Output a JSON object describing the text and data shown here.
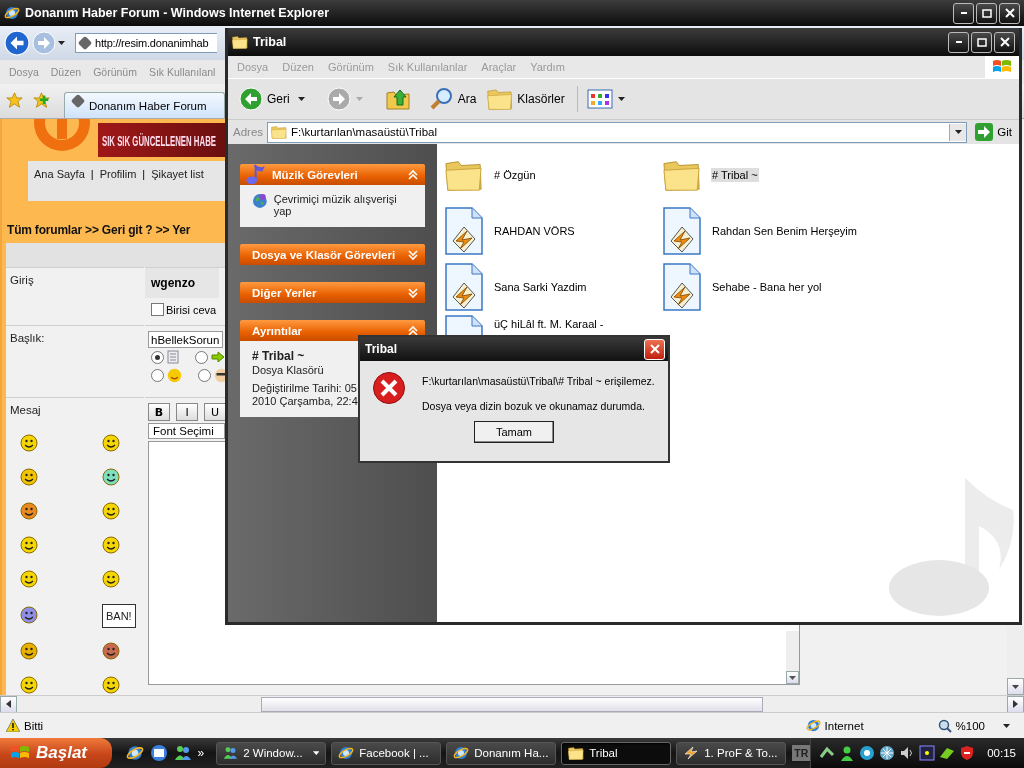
{
  "ie_window": {
    "title": "Donanım Haber Forum - Windows Internet Explorer",
    "address": "http://resim.donanimhab",
    "menu": [
      "Dosya",
      "Düzen",
      "Görünüm",
      "Sık Kullanılanl"
    ],
    "tabs": [
      {
        "label": "Donanım Haber Forum",
        "selected": true
      }
    ],
    "page": {
      "banner_text": "SIK SIK GÜNCELLENEN HABE",
      "nav": [
        {
          "kind": "link",
          "label": "Ana Sayfa"
        },
        {
          "kind": "separator",
          "label": "|"
        },
        {
          "kind": "link",
          "label": "Profilim"
        },
        {
          "kind": "separator",
          "label": "|"
        },
        {
          "kind": "link",
          "label": "Şikayet list"
        }
      ],
      "breadcrumb": "Tüm forumlar >> Geri git ? >> Yer",
      "labels": [
        "Giriş",
        "Başlık:",
        "Mesaj"
      ],
      "username": "wgenzo",
      "notify": {
        "label": "Birisi ceva",
        "checked": false
      },
      "title_value": "hBellekSorun",
      "icon_radios": [
        {
          "selected": true
        },
        {
          "selected": false
        },
        {
          "selected": false
        },
        {
          "selected": false
        }
      ],
      "format_buttons": [
        "B",
        "I",
        "U"
      ],
      "font_select": "Font Seçimi",
      "ban_sign": "BAN!"
    },
    "status": {
      "text": "Bitti",
      "zone": "Internet",
      "zoom": "%100"
    }
  },
  "explorer": {
    "title": "Tribal",
    "menu": [
      "Dosya",
      "Düzen",
      "Görünüm",
      "Sık Kullanılanlar",
      "Araçlar",
      "Yardım"
    ],
    "toolbar": {
      "back": "Geri",
      "search": "Ara",
      "folders": "Klasörler"
    },
    "address_label": "Adres",
    "address": "F:\\kurtarılan\\masaüstü\\Tribal",
    "go": "Git",
    "panels": [
      {
        "title": "Müzik Görevleri",
        "kind": "music",
        "expanded": true,
        "items": [
          "Çevrimiçi müzik alışverişi yap"
        ]
      },
      {
        "title": "Dosya ve Klasör Görevleri",
        "kind": "plain",
        "expanded": false
      },
      {
        "title": "Diğer Yerler",
        "kind": "plain",
        "expanded": false
      },
      {
        "title": "Ayrıntılar",
        "kind": "details",
        "expanded": true,
        "name": "# Tribal ~",
        "type": "Dosya Klasörü",
        "modified": [
          "Değiştirilme Tarihi: 05",
          "2010 Çarşamba, 22:4"
        ]
      }
    ],
    "files": [
      {
        "name": "# Özgün",
        "kind": "folder",
        "selected": false
      },
      {
        "name": "# Tribal ~",
        "kind": "folder",
        "selected": true
      },
      {
        "name": "RAHDAN VÖRS",
        "kind": "audio",
        "selected": false
      },
      {
        "name": "Rahdan Sen Benim Herşeyim",
        "kind": "audio",
        "selected": false
      },
      {
        "name": "Sana Sarki Yazdim",
        "kind": "audio",
        "selected": false
      },
      {
        "name": "Sehabe - Bana her yol",
        "kind": "audio",
        "selected": false
      },
      {
        "name": "üÇ hiLâl ft. M. Karaal -",
        "kind": "audio",
        "selected": false,
        "wrapped": true
      }
    ]
  },
  "dialog": {
    "title": "Tribal",
    "message": "F:\\kurtarılan\\masaüstü\\Tribal\\# Tribal ~ erişilemez.",
    "detail": "Dosya veya dizin bozuk ve okunamaz durumda.",
    "button": "Tamam"
  },
  "taskbar": {
    "start": "Başlat",
    "more": "»",
    "tasks": [
      {
        "label": "2 Window...",
        "kind": "group",
        "selected": false
      },
      {
        "label": "Facebook | ...",
        "kind": "browser",
        "selected": false
      },
      {
        "label": "Donanım Ha...",
        "kind": "browser",
        "selected": false
      },
      {
        "label": "Tribal",
        "kind": "folder",
        "selected": true
      },
      {
        "label": "1. ProF & To...",
        "kind": "player",
        "selected": false
      }
    ],
    "language": "TR",
    "clock": "00:15"
  }
}
